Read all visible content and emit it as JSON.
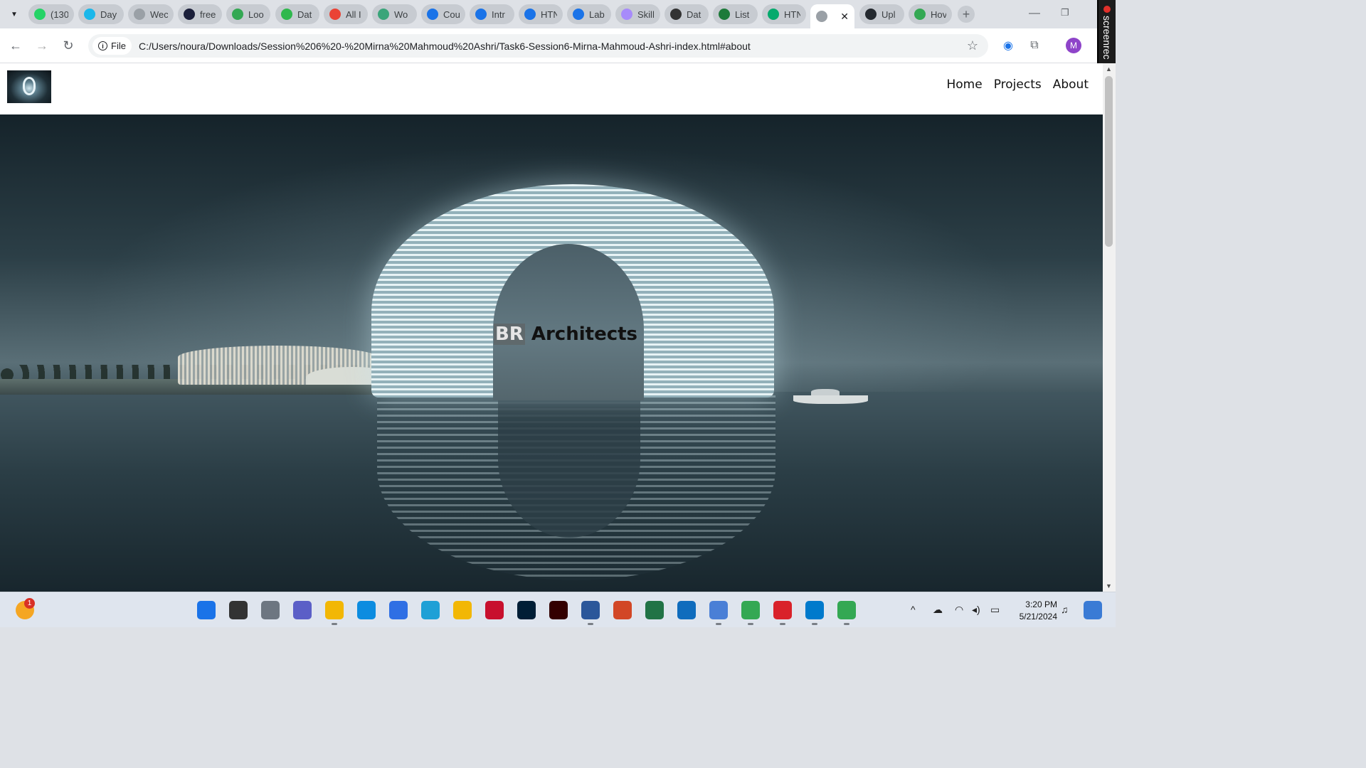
{
  "browser": {
    "tabs": [
      {
        "title": "(130",
        "icon": "whatsapp-icon",
        "color": "#25d366"
      },
      {
        "title": "Day",
        "icon": "vimeo-icon",
        "color": "#1ab7ea"
      },
      {
        "title": "Wec",
        "icon": "globe-icon",
        "color": "#9aa0a6"
      },
      {
        "title": "free",
        "icon": "app-icon",
        "color": "#1b1f3a"
      },
      {
        "title": "Loo",
        "icon": "app-icon",
        "color": "#34a853"
      },
      {
        "title": "Dat",
        "icon": "app-icon",
        "color": "#2fb84d"
      },
      {
        "title": "All I",
        "icon": "gmail-icon",
        "color": "#ea4335"
      },
      {
        "title": "Wo",
        "icon": "globe-icon",
        "color": "#3aa57a"
      },
      {
        "title": "Cou",
        "icon": "coursera-icon",
        "color": "#1a73e8"
      },
      {
        "title": "Intr",
        "icon": "coursera-icon",
        "color": "#1a73e8"
      },
      {
        "title": "HTN",
        "icon": "coursera-icon",
        "color": "#1a73e8"
      },
      {
        "title": "Lab",
        "icon": "coursera-icon",
        "color": "#1a73e8"
      },
      {
        "title": "Skill",
        "icon": "app-icon",
        "color": "#a78bfa"
      },
      {
        "title": "Dat",
        "icon": "chatgpt-icon",
        "color": "#333333"
      },
      {
        "title": "List",
        "icon": "app-icon",
        "color": "#1d7a3a"
      },
      {
        "title": "HTN",
        "icon": "w3schools-icon",
        "color": "#04aa6d"
      },
      {
        "title": "",
        "icon": "globe-icon",
        "color": "#9aa0a6",
        "active": true
      },
      {
        "title": "Upl",
        "icon": "github-icon",
        "color": "#24292f"
      },
      {
        "title": "Hov",
        "icon": "app-icon",
        "color": "#34a853"
      }
    ],
    "chip_label": "File",
    "url": "C:/Users/noura/Downloads/Session%206%20-%20Mirna%20Mahmoud%20Ashri/Task6-Session6-Mirna-Mahmoud-Ashri-index.html#about",
    "avatar_letter": "M",
    "recorder_label": "screenrec"
  },
  "page": {
    "nav": [
      {
        "label": "Home"
      },
      {
        "label": "Projects"
      },
      {
        "label": "About"
      }
    ],
    "hero": {
      "highlight": "BR",
      "rest": " Architects"
    }
  },
  "taskbar": {
    "notification_count": "1",
    "apps": [
      "start-icon",
      "search-icon",
      "task-view-icon",
      "teams-icon",
      "file-explorer-icon",
      "edge-icon",
      "store-icon",
      "myhp-icon",
      "helper-icon",
      "mcafee-icon",
      "photoshop-icon",
      "illustrator-icon",
      "word-icon",
      "powerpoint-icon",
      "excel-icon",
      "outlook-icon",
      "app-icon",
      "chrome-icon",
      "acrobat-icon",
      "vscode-icon",
      "chrome-icon"
    ],
    "time": "3:20 PM",
    "date": "5/21/2024"
  }
}
